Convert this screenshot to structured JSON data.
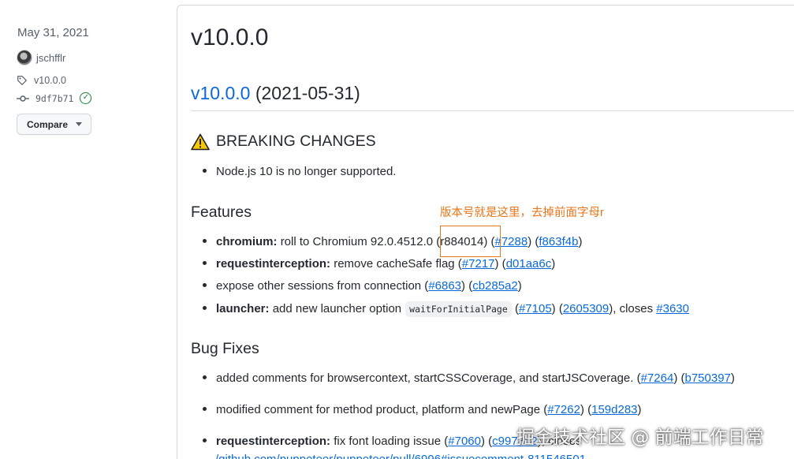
{
  "sidebar": {
    "date": "May 31, 2021",
    "author": "jschfflr",
    "tag": "v10.0.0",
    "commit": "9df7b71",
    "compare_label": "Compare"
  },
  "release": {
    "title": "v10.0.0",
    "version_link": "v10.0.0",
    "date_paren": "(2021-05-31)"
  },
  "breaking": {
    "heading": "BREAKING CHANGES",
    "items": [
      {
        "text": "Node.js 10 is no longer supported."
      }
    ]
  },
  "features": {
    "heading": "Features",
    "items": [
      {
        "scope": "chromium:",
        "text": "roll to Chromium 92.0.4512.0 (r884014) (",
        "link1": "#7288",
        "mid": ") (",
        "link2": "f863f4b",
        "end": ")"
      },
      {
        "scope": "requestinterception:",
        "text": "remove cacheSafe flag (",
        "link1": "#7217",
        "mid": ") (",
        "link2": "d01aa6c",
        "end": ")"
      },
      {
        "text": "expose other sessions from connection (",
        "link1": "#6863",
        "mid": ") (",
        "link2": "cb285a2",
        "end": ")"
      },
      {
        "scope": "launcher:",
        "text": "add new launcher option",
        "code": "waitForInitialPage",
        "pre": "(",
        "link1": "#7105",
        "mid": ") (",
        "link2": "2605309",
        "end": "), closes",
        "link3": "#3630"
      }
    ]
  },
  "bugfixes": {
    "heading": "Bug Fixes",
    "items": [
      {
        "text": "added comments for browsercontext, startCSSCoverage, and startJSCoverage. (",
        "link1": "#7264",
        "mid": ") (",
        "link2": "b750397",
        "end": ")"
      },
      {
        "text": "modified comment for method product, platform and newPage (",
        "link1": "#7262",
        "mid": ") (",
        "link2": "159d283",
        "end": ")"
      },
      {
        "scope": "requestinterception:",
        "text": "fix font loading issue (",
        "link1": "#7060",
        "mid": ") (",
        "link2": "c9978d2",
        "end": "), closes"
      }
    ],
    "url_fragment": "/github.com/puppeteer/puppeteer/pull/6996#issuecomment-811546501"
  },
  "annotation": {
    "text": "版本号就是这里，去掉前面字母r",
    "color": "#e8761b"
  },
  "watermark": "掘金技术社区 @ 前端工作日常",
  "colors": {
    "link": "#0969da",
    "text": "#24292f",
    "muted": "#57606a",
    "success": "#1a7f37"
  }
}
